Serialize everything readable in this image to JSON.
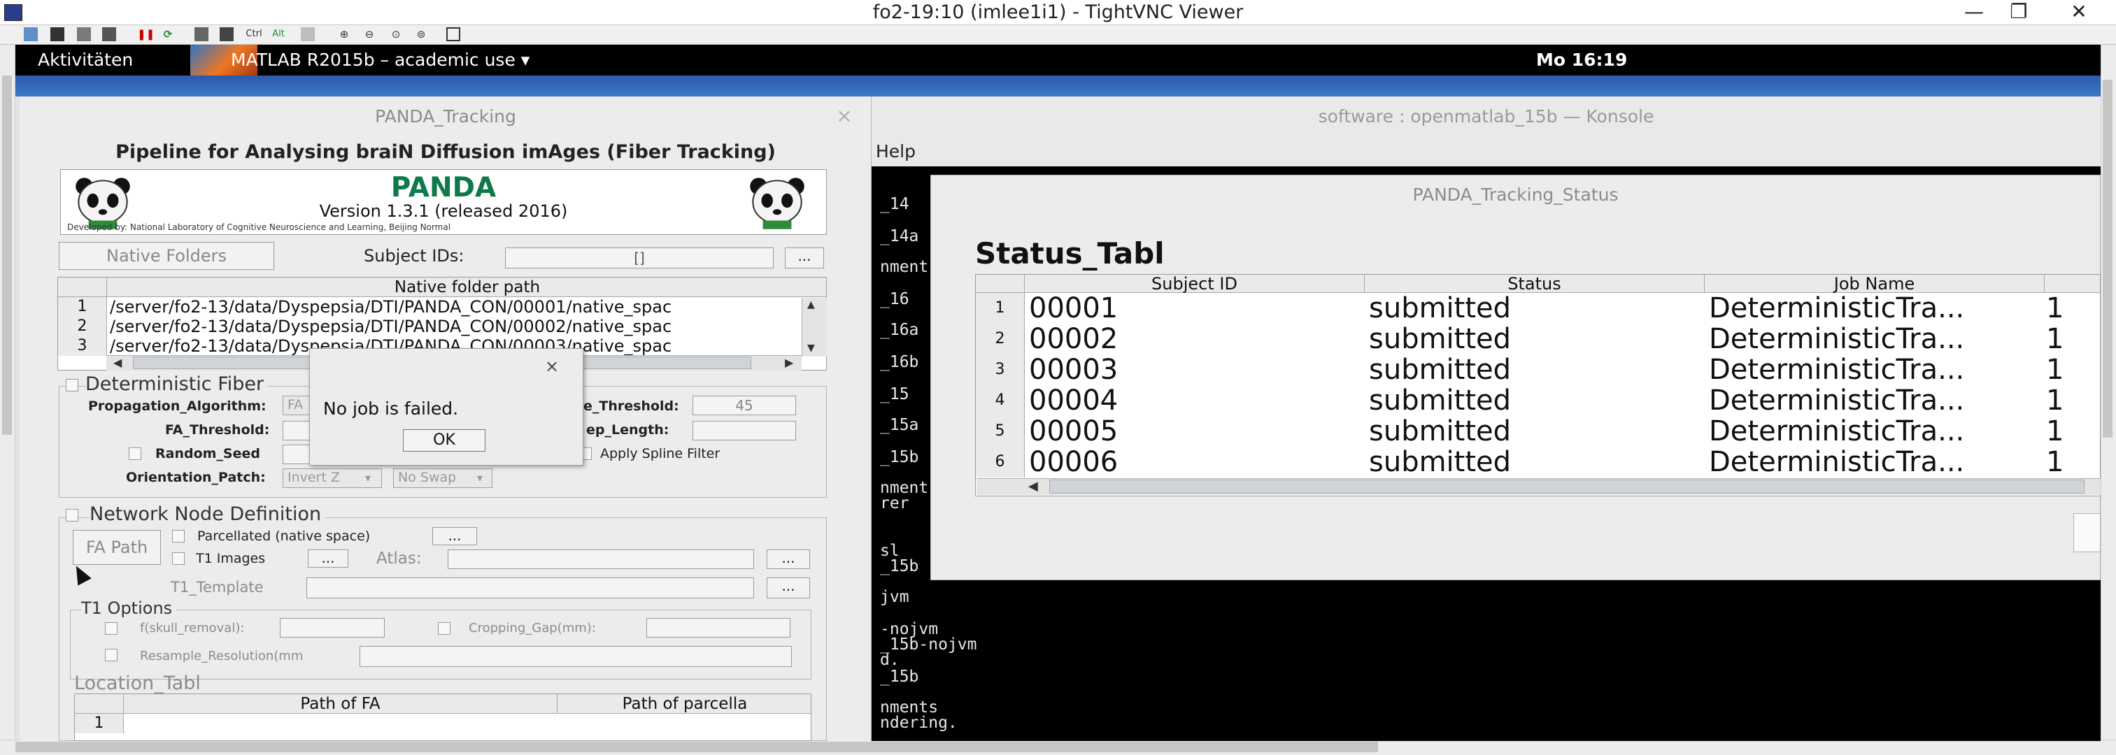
{
  "vnc": {
    "title": "fo2-19:10 (imlee1i1) - TightVNC Viewer",
    "minimize": "—",
    "restore": "❐",
    "close": "✕",
    "toolbar_icons": [
      "new-connection-icon",
      "save-icon",
      "options-icon",
      "info-icon",
      "pause-icon",
      "refresh-icon",
      "ctrl-alt-del-icon",
      "ctrl-esc-icon",
      "ctrl-key-icon",
      "alt-key-icon",
      "clipboard-icon",
      "zoom-in-icon",
      "zoom-out-icon",
      "zoom-100-icon",
      "zoom-fit-icon",
      "fullscreen-icon"
    ],
    "toolbar_ctrl": "Ctrl",
    "toolbar_alt": "Alt"
  },
  "gnome": {
    "activities": "Aktivitäten",
    "app_menu": "MATLAB R2015b – academic use ▾",
    "clock": "Mo 16:19"
  },
  "konsole": {
    "title": "software : openmatlab_15b — Konsole",
    "menu_help": "Help",
    "lines": [
      "_14",
      "_14a",
      "nment",
      "_16",
      "_16a",
      "_16b",
      "_15",
      "_15a",
      "_15b",
      "nment",
      "  rer",
      "sl",
      "_15b",
      "jvm",
      "-nojvm",
      "_15b-nojvm",
      "d.",
      "_15b",
      "nments",
      "ndering."
    ]
  },
  "status": {
    "window_title": "PANDA_Tracking_Status",
    "heading": "Status_Tabl",
    "columns": [
      "Subject ID",
      "Status",
      "Job Name"
    ],
    "rows": [
      {
        "index": "1",
        "subject": "00001",
        "status": "submitted",
        "job": "DeterministicTra...",
        "extra": "1"
      },
      {
        "index": "2",
        "subject": "00002",
        "status": "submitted",
        "job": "DeterministicTra...",
        "extra": "1"
      },
      {
        "index": "3",
        "subject": "00003",
        "status": "submitted",
        "job": "DeterministicTra...",
        "extra": "1"
      },
      {
        "index": "4",
        "subject": "00004",
        "status": "submitted",
        "job": "DeterministicTra...",
        "extra": "1"
      },
      {
        "index": "5",
        "subject": "00005",
        "status": "submitted",
        "job": "DeterministicTra...",
        "extra": "1"
      },
      {
        "index": "6",
        "subject": "00006",
        "status": "submitted",
        "job": "DeterministicTra...",
        "extra": "1"
      }
    ]
  },
  "panda": {
    "window_title": "PANDA_Tracking",
    "close": "×",
    "pipeline": "Pipeline for Analysing braiN Diffusion imAges (Fiber Tracking)",
    "banner_word": "PANDA",
    "version": "Version 1.3.1 (released 2016)",
    "developed_by": "Developed by: National Laboratory of Cognitive Neuroscience and Learning, Beijing Normal",
    "native_folders_btn": "Native Folders",
    "subject_ids_label": "Subject IDs:",
    "subject_ids_value": "[]",
    "ellipsis": "...",
    "native_table_header": "Native folder path",
    "native_rows": [
      {
        "index": "1",
        "path": "/server/fo2-13/data/Dyspepsia/DTI/PANDA_CON/00001/native_spac"
      },
      {
        "index": "2",
        "path": "/server/fo2-13/data/Dyspepsia/DTI/PANDA_CON/00002/native_spac"
      },
      {
        "index": "3",
        "path": "/server/fo2-13/data/Dyspepsia/DTI/PANDA_CON/00003/native_spac"
      }
    ],
    "det_fiber_title": "Deterministic Fiber",
    "propagation_label": "Propagation_Algorithm:",
    "propagation_value": "FA",
    "angle_threshold_label": "e_Threshold:",
    "angle_threshold_value": "45",
    "fa_threshold_label": "FA_Threshold:",
    "step_length_label": "ep_Length:",
    "random_seed_label": "Random_Seed",
    "apply_spline_label": "Apply Spline Filter",
    "orientation_patch_label": "Orientation_Patch:",
    "invert_value": "Invert Z",
    "swap_value": "No Swap",
    "network_title": "Network Node Definition",
    "fa_path_btn": "FA Path",
    "parcellated_label": "Parcellated (native space)",
    "t1_images_label": "T1 Images",
    "atlas_label": "Atlas:",
    "t1_template_label": "T1_Template",
    "t1_options_title": "T1 Options",
    "skull_removal_label": "f(skull_removal):",
    "cropping_gap_label": "Cropping_Gap(mm):",
    "resample_label": "Resample_Resolution(mm",
    "location_title": "Location_Tabl",
    "location_columns": [
      "Path of FA",
      "Path of parcella"
    ],
    "location_row_index": "1"
  },
  "dialog": {
    "close": "×",
    "message": "No job is failed.",
    "ok": "OK"
  }
}
